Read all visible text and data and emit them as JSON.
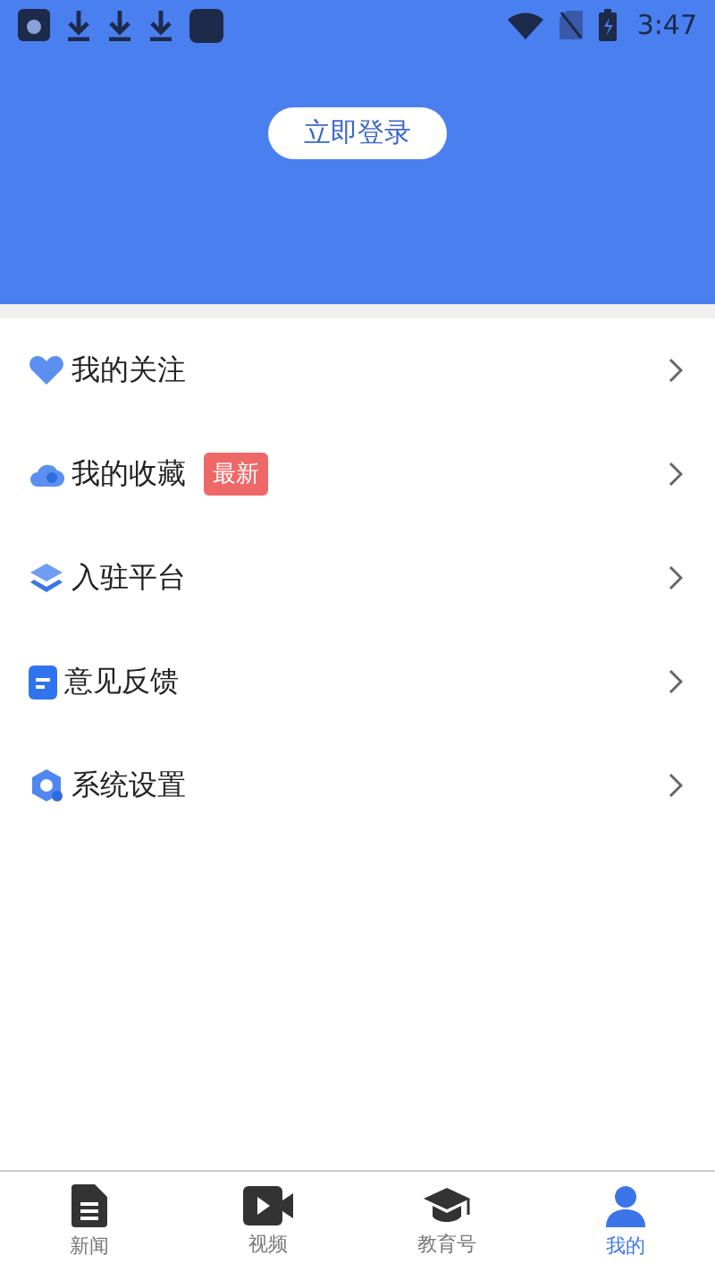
{
  "status_bar": {
    "time": "3:47"
  },
  "header": {
    "login_button": "立即登录"
  },
  "menu": [
    {
      "label": "我的关注"
    },
    {
      "label": "我的收藏",
      "badge": "最新"
    },
    {
      "label": "入驻平台"
    },
    {
      "label": "意见反馈"
    },
    {
      "label": "系统设置"
    }
  ],
  "tabs": [
    {
      "label": "新闻",
      "selected": false
    },
    {
      "label": "视频",
      "selected": false
    },
    {
      "label": "教育号",
      "selected": false
    },
    {
      "label": "我的",
      "selected": true
    }
  ]
}
